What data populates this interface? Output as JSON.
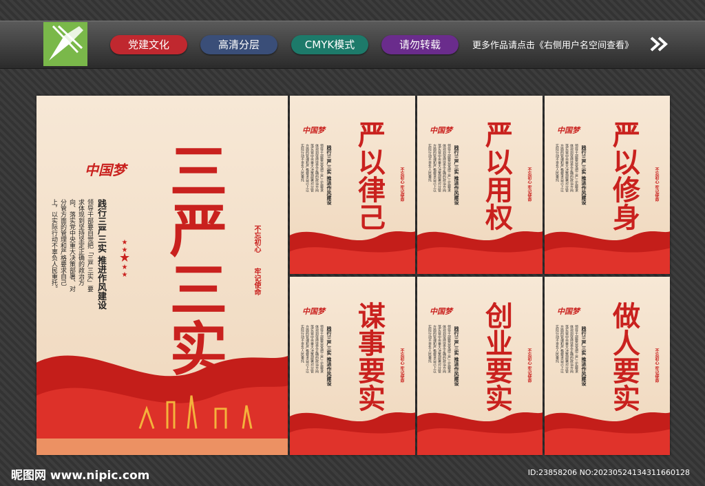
{
  "header": {
    "logo_icon": "pen-nib-icon",
    "tags": [
      {
        "label": "党建文化",
        "color": "#c0282f"
      },
      {
        "label": "高清分层",
        "color": "#3a4e78"
      },
      {
        "label": "CMYK模式",
        "color": "#1d7a6a"
      },
      {
        "label": "请勿转载",
        "color": "#6a2c8c"
      }
    ],
    "notice": "更多作品请点击《右侧用户名空间查看》",
    "arrow_icon": "double-chevron-right-icon"
  },
  "main_poster": {
    "brand": "中国梦",
    "title": "三严三实",
    "subtitle": "践行三严三实 推进作风建设",
    "body": "领导干部要自觉把「三严三实」要求体现到坚持坚定正确的政治方向、落实党中央重大决策部署、对分管方面的管理和严格要求自己上，以实际行动不辜负人民重托。",
    "slogan_1": "不忘初心",
    "slogan_2": "牢记使命"
  },
  "small_posters": [
    {
      "title": "严以律己",
      "brand": "中国梦",
      "subtitle": "践行三严三实 推进作风建设",
      "body": "领导干部要自觉把三严三实要求体现到坚持坚定正确的政治方向落实党中央重大决策部署对分管方面的管理和严格要求自己上以实际行动不辜负人民重托",
      "slogan": "不忘初心 牢记使命"
    },
    {
      "title": "严以用权",
      "brand": "中国梦",
      "subtitle": "践行三严三实 推进作风建设",
      "body": "领导干部要自觉把三严三实要求体现到坚持坚定正确的政治方向落实党中央重大决策部署对分管方面的管理和严格要求自己上以实际行动不辜负人民重托",
      "slogan": "不忘初心 牢记使命"
    },
    {
      "title": "严以修身",
      "brand": "中国梦",
      "subtitle": "践行三严三实 推进作风建设",
      "body": "领导干部要自觉把三严三实要求体现到坚持坚定正确的政治方向落实党中央重大决策部署对分管方面的管理和严格要求自己上以实际行动不辜负人民重托",
      "slogan": "不忘初心 牢记使命"
    },
    {
      "title": "谋事要实",
      "brand": "中国梦",
      "subtitle": "践行三严三实 推进作风建设",
      "body": "领导干部要自觉把三严三实要求体现到坚持坚定正确的政治方向落实党中央重大决策部署对分管方面的管理和严格要求自己上以实际行动不辜负人民重托",
      "slogan": "不忘初心 牢记使命"
    },
    {
      "title": "创业要实",
      "brand": "中国梦",
      "subtitle": "践行三严三实 推进作风建设",
      "body": "领导干部要自觉把三严三实要求体现到坚持坚定正确的政治方向落实党中央重大决策部署对分管方面的管理和严格要求自己上以实际行动不辜负人民重托",
      "slogan": "不忘初心 牢记使命"
    },
    {
      "title": "做人要实",
      "brand": "中国梦",
      "subtitle": "践行三严三实 推进作风建设",
      "body": "领导干部要自觉把三严三实要求体现到坚持坚定正确的政治方向落实党中央重大决策部署对分管方面的管理和严格要求自己上以实际行动不辜负人民重托",
      "slogan": "不忘初心 牢记使命"
    }
  ],
  "footer": {
    "site": "昵图网 www.nipic.com",
    "id_text": "ID:23858206 NO:20230524134311660128"
  },
  "colors": {
    "accent_red": "#c9211e",
    "poster_bg": "#f5e4cf"
  }
}
